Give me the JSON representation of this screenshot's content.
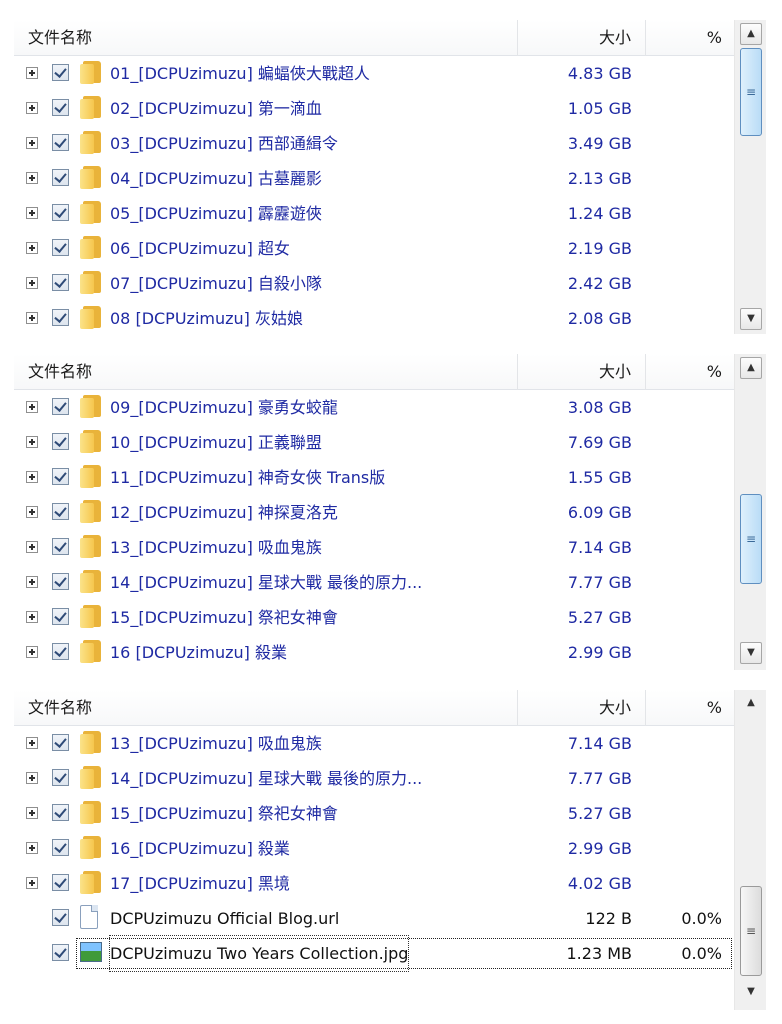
{
  "columns": {
    "name": "文件名称",
    "size": "大小",
    "percent": "%"
  },
  "scroll": {
    "up": "▲",
    "down": "▼"
  },
  "panel1": {
    "rows": [
      {
        "name": "01_[DCPUzimuzu] 蝙蝠俠大戰超人",
        "size": "4.83 GB",
        "pct": ""
      },
      {
        "name": "02_[DCPUzimuzu] 第一滴血",
        "size": "1.05 GB",
        "pct": ""
      },
      {
        "name": "03_[DCPUzimuzu] 西部通緝令",
        "size": "3.49 GB",
        "pct": ""
      },
      {
        "name": "04_[DCPUzimuzu] 古墓麗影",
        "size": "2.13 GB",
        "pct": ""
      },
      {
        "name": "05_[DCPUzimuzu] 霹靂遊俠",
        "size": "1.24 GB",
        "pct": ""
      },
      {
        "name": "06_[DCPUzimuzu] 超女",
        "size": "2.19 GB",
        "pct": ""
      },
      {
        "name": "07_[DCPUzimuzu] 自殺小隊",
        "size": "2.42 GB",
        "pct": ""
      },
      {
        "name": "08 [DCPUzimuzu] 灰姑娘",
        "size": "2.08 GB",
        "pct": ""
      }
    ]
  },
  "panel2": {
    "rows": [
      {
        "name": "09_[DCPUzimuzu] 豪勇女蛟龍",
        "size": "3.08 GB",
        "pct": ""
      },
      {
        "name": "10_[DCPUzimuzu] 正義聯盟",
        "size": "7.69 GB",
        "pct": ""
      },
      {
        "name": "11_[DCPUzimuzu] 神奇女俠 Trans版",
        "size": "1.55 GB",
        "pct": ""
      },
      {
        "name": "12_[DCPUzimuzu] 神探夏洛克",
        "size": "6.09 GB",
        "pct": ""
      },
      {
        "name": "13_[DCPUzimuzu] 吸血鬼族",
        "size": "7.14 GB",
        "pct": ""
      },
      {
        "name": "14_[DCPUzimuzu] 星球大戰 最後的原力...",
        "size": "7.77 GB",
        "pct": ""
      },
      {
        "name": "15_[DCPUzimuzu] 祭祀女神會",
        "size": "5.27 GB",
        "pct": ""
      },
      {
        "name": "16 [DCPUzimuzu] 殺業",
        "size": "2.99 GB",
        "pct": ""
      }
    ]
  },
  "panel3": {
    "rows": [
      {
        "name": "13_[DCPUzimuzu] 吸血鬼族",
        "size": "7.14 GB",
        "pct": ""
      },
      {
        "name": "14_[DCPUzimuzu] 星球大戰 最後的原力...",
        "size": "7.77 GB",
        "pct": ""
      },
      {
        "name": "15_[DCPUzimuzu] 祭祀女神會",
        "size": "5.27 GB",
        "pct": ""
      },
      {
        "name": "16_[DCPUzimuzu] 殺業",
        "size": "2.99 GB",
        "pct": ""
      },
      {
        "name": "17_[DCPUzimuzu] 黑境",
        "size": "4.02 GB",
        "pct": ""
      },
      {
        "name": "DCPUzimuzu Official Blog.url",
        "size": "122 B",
        "pct": "0.0%"
      },
      {
        "name": "DCPUzimuzu Two Years Collection.jpg",
        "size": "1.23 MB",
        "pct": "0.0%"
      }
    ]
  },
  "colors": {
    "folder_text": "#1f2aa3",
    "file_text": "#111111",
    "thumb": "#b9dcf6"
  }
}
